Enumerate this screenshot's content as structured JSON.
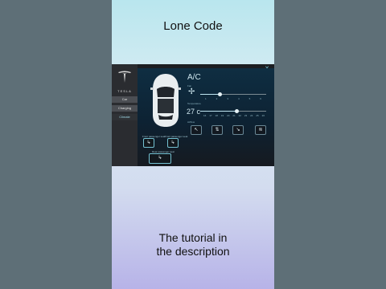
{
  "page": {
    "title": "Lone Code",
    "caption_line1": "The tutorial in",
    "caption_line2": "the description"
  },
  "app": {
    "close_glyph": "✕",
    "logo_text": "TESLA",
    "nav": [
      {
        "label": "Car",
        "active": false
      },
      {
        "label": "Charging",
        "active": false
      },
      {
        "label": "Climate",
        "active": true
      }
    ],
    "climate": {
      "ac_label": "A/C",
      "fan_label": "Fan",
      "fan_level_fraction": 0.3,
      "fan_ticks": [
        "1",
        "2",
        "3",
        "4",
        "5",
        "6"
      ],
      "temperature_label": "Temperature",
      "temperature_value": "27 c",
      "temp_level_fraction": 0.55,
      "temp_ticks": [
        "16",
        "17",
        "18",
        "19",
        "20",
        "21",
        "22",
        "23",
        "24",
        "25",
        "26"
      ],
      "airflow_label": "Airflow",
      "modes": [
        {
          "icon": "airflow-face-icon"
        },
        {
          "icon": "airflow-face-feet-icon"
        },
        {
          "icon": "airflow-feet-icon"
        },
        {
          "icon": "airflow-defrost-icon"
        }
      ],
      "seats": {
        "front_left_label": "Front passenger seat",
        "front_right_label": "Front passenger seat",
        "rear_label": "Rear passenger seat"
      }
    }
  }
}
